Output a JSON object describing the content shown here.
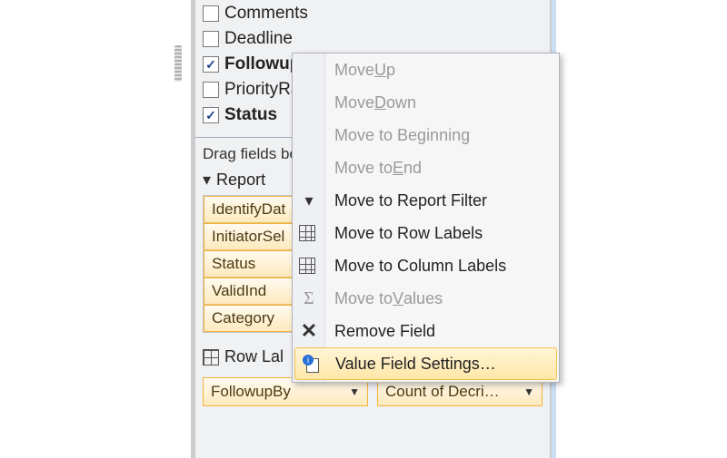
{
  "fields": [
    {
      "label": "Comments",
      "checked": false,
      "bold": false
    },
    {
      "label": "Deadline",
      "checked": false,
      "bold": false
    },
    {
      "label": "Followup",
      "checked": true,
      "bold": true
    },
    {
      "label": "PriorityRa",
      "checked": false,
      "bold": false
    },
    {
      "label": "Status",
      "checked": true,
      "bold": true
    }
  ],
  "drag_hint": "Drag fields be",
  "report_filter_header": "Report",
  "report_filter_items": [
    "IdentifyDat",
    "InitiatorSel",
    "Status",
    "ValidInd",
    "Category"
  ],
  "row_labels_header": "Row Lal",
  "dropdowns": {
    "left": "FollowupBy",
    "right": "Count of Decri…"
  },
  "menu": {
    "move_up_pre": "Move ",
    "move_up_u": "U",
    "move_up_post": "p",
    "move_down_pre": "Move ",
    "move_down_u": "D",
    "move_down_post": "own",
    "move_beg_pre": "Move to Be",
    "move_beg_u": "g",
    "move_beg_post": "inning",
    "move_end_pre": "Move to ",
    "move_end_u": "E",
    "move_end_post": "nd",
    "move_report": "Move to Report Filter",
    "move_rows": "Move to Row Labels",
    "move_cols": "Move to Column Labels",
    "move_values_pre": "Move to ",
    "move_values_u": "V",
    "move_values_post": "alues",
    "remove": "Remove Field",
    "value_settings": "Value Field Settings…"
  }
}
